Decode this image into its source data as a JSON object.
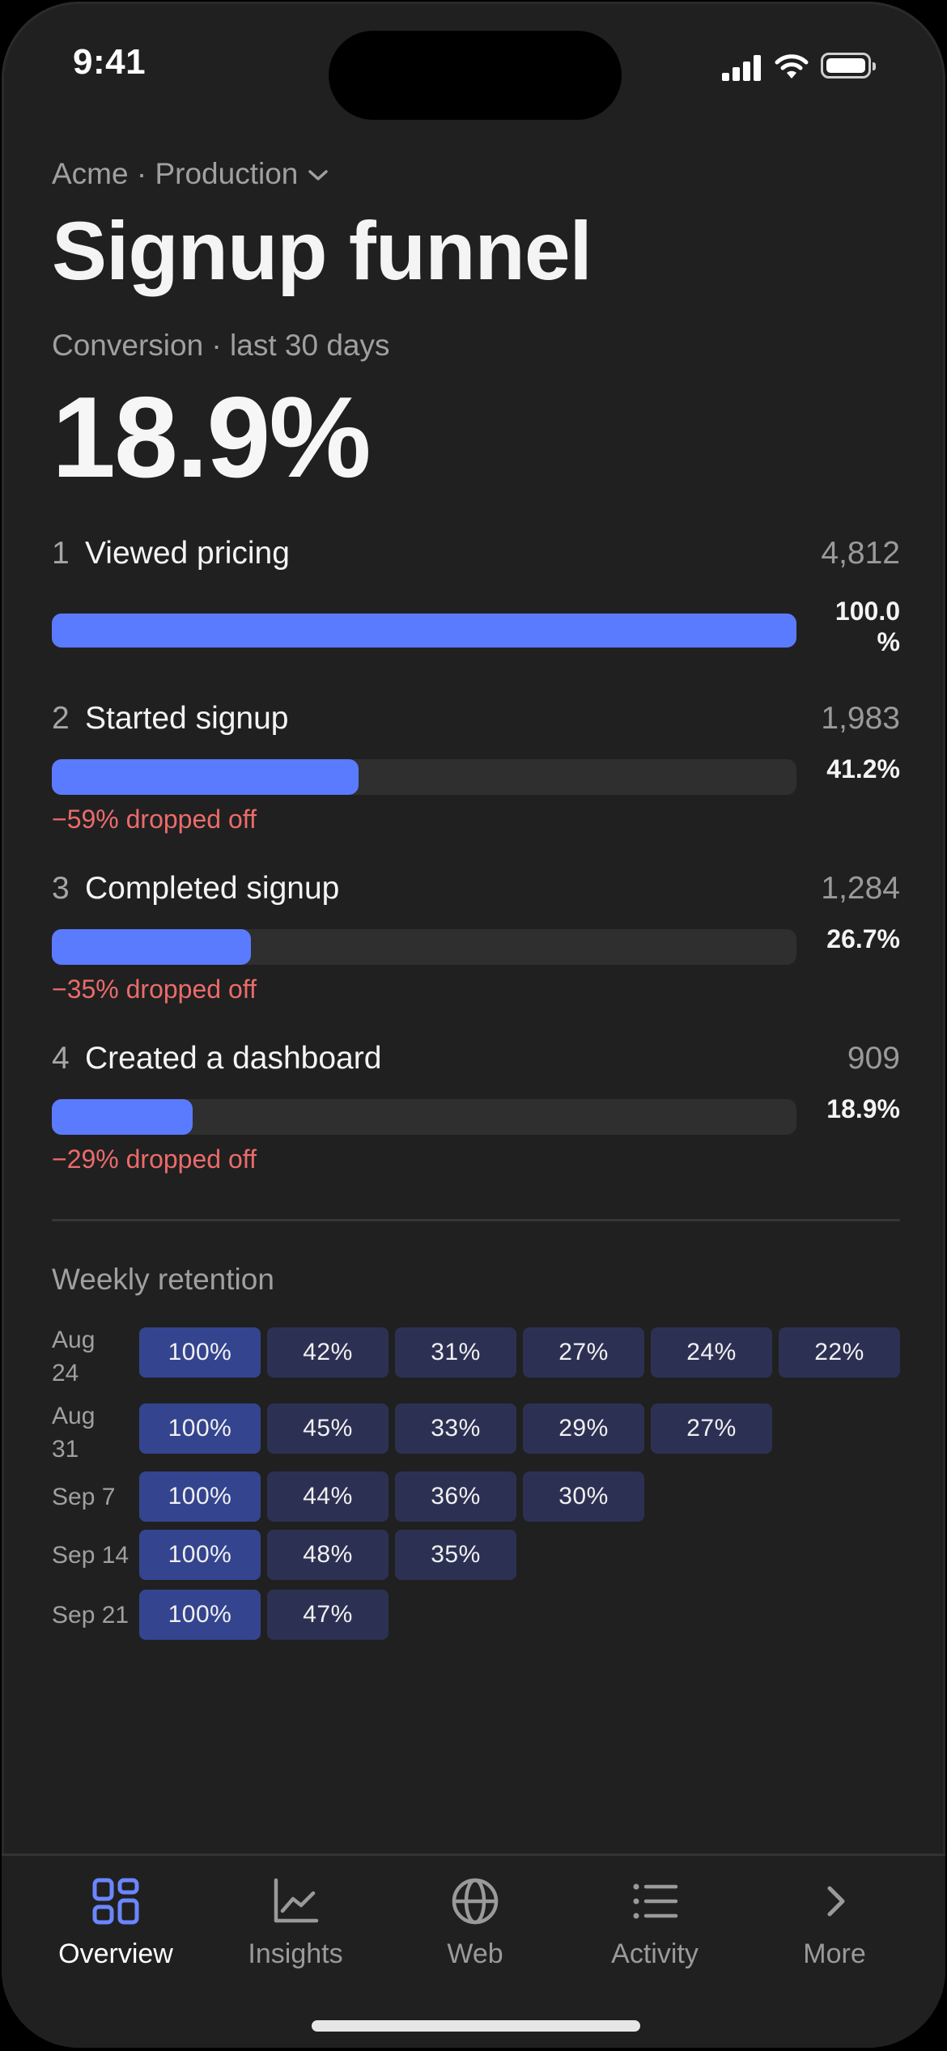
{
  "status_bar": {
    "time": "9:41"
  },
  "header": {
    "project": "Acme · Production",
    "title": "Signup funnel",
    "subtitle": "Conversion · last 30 days",
    "conversion": "18.9%"
  },
  "funnel": [
    {
      "num": "1",
      "name": "Viewed pricing",
      "count": "4,812",
      "pct": "100.0 %",
      "fill": 1.0,
      "drop": ""
    },
    {
      "num": "2",
      "name": "Started signup",
      "count": "1,983",
      "pct": "41.2%",
      "fill": 0.412,
      "drop": "−59% dropped off"
    },
    {
      "num": "3",
      "name": "Completed signup",
      "count": "1,284",
      "pct": "26.7%",
      "fill": 0.267,
      "drop": "−35% dropped off"
    },
    {
      "num": "4",
      "name": "Created a dashboard",
      "count": "909",
      "pct": "18.9%",
      "fill": 0.189,
      "drop": "−29% dropped off"
    }
  ],
  "retention": {
    "title": "Weekly retention",
    "rows": [
      {
        "label": "Aug 24",
        "cells": [
          "100%",
          "42%",
          "31%",
          "27%",
          "24%",
          "22%"
        ]
      },
      {
        "label": "Aug 31",
        "cells": [
          "100%",
          "45%",
          "33%",
          "29%",
          "27%"
        ]
      },
      {
        "label": "Sep 7",
        "cells": [
          "100%",
          "44%",
          "36%",
          "30%"
        ]
      },
      {
        "label": "Sep 14",
        "cells": [
          "100%",
          "48%",
          "35%"
        ]
      },
      {
        "label": "Sep 21",
        "cells": [
          "100%",
          "47%"
        ]
      }
    ]
  },
  "tabbar": {
    "tabs": [
      {
        "label": "Overview",
        "icon": "grid-icon",
        "active": true
      },
      {
        "label": "Insights",
        "icon": "chart-icon",
        "active": false
      },
      {
        "label": "Web",
        "icon": "globe-icon",
        "active": false
      },
      {
        "label": "Activity",
        "icon": "list-icon",
        "active": false
      },
      {
        "label": "More",
        "icon": "chevron-right-icon",
        "active": false
      }
    ]
  },
  "colors": {
    "accent": "#5b7bff",
    "drop": "#ec6b6b",
    "background": "#202020",
    "cell_full": "#34448f",
    "cell_partial": "#2c3154"
  }
}
